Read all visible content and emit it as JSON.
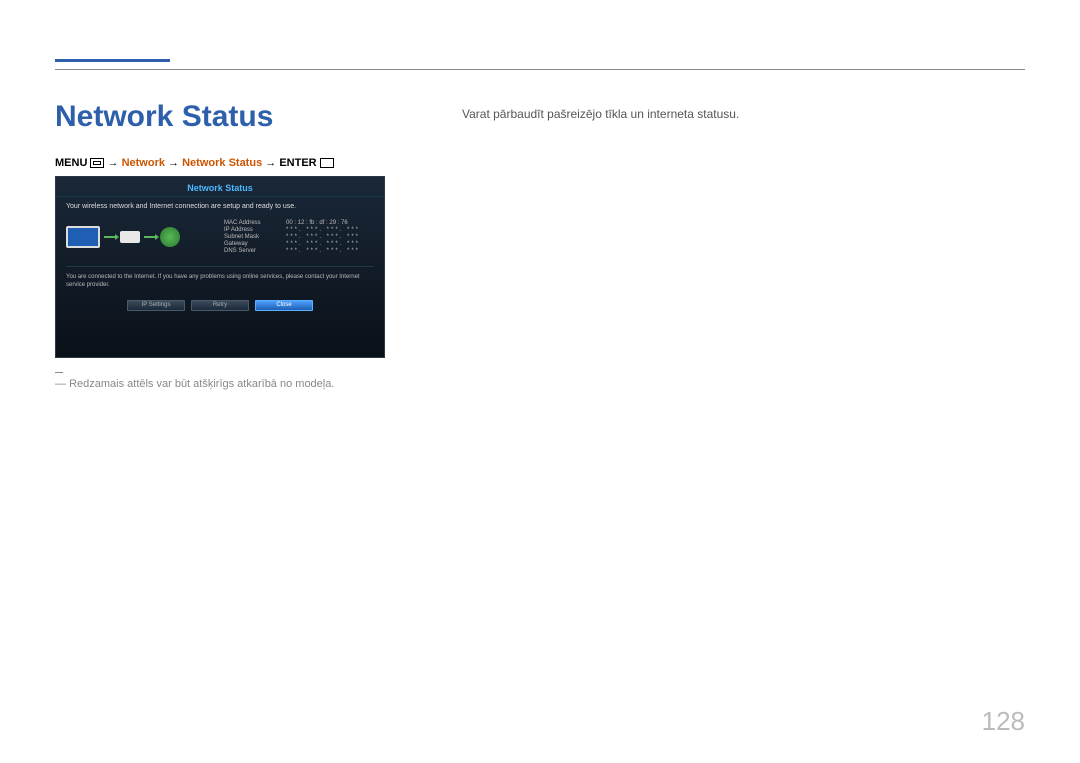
{
  "page": {
    "title": "Network Status",
    "description": "Varat pārbaudīt pašreizējo tīkla un interneta statusu.",
    "note": "Redzamais attēls var būt atšķirīgs atkarībā no modeļa.",
    "pageNumber": "128"
  },
  "breadcrumb": {
    "menu": "MENU",
    "arrow": "→",
    "path1": "Network",
    "path2": "Network Status",
    "enter": "ENTER"
  },
  "osd": {
    "title": "Network Status",
    "statusMessage": "Your wireless network and Internet connection are setup and ready to use.",
    "details": {
      "mac": {
        "label": "MAC Address",
        "value": "00 : 12 : fb : df : 29 : 76"
      },
      "ip": {
        "label": "IP Address",
        "value": "***. ***. ***. ***"
      },
      "subnet": {
        "label": "Subnet Mask",
        "value": "***. ***. ***. ***"
      },
      "gateway": {
        "label": "Gateway",
        "value": "***. ***. ***. ***"
      },
      "dns": {
        "label": "DNS Server",
        "value": "***. ***. ***. ***"
      }
    },
    "infoText": "You are connected to the Internet. If you have any problems using online services, please contact your Internet service provider.",
    "buttons": {
      "ipSettings": "IP Settings",
      "retry": "Retry",
      "close": "Close"
    }
  }
}
